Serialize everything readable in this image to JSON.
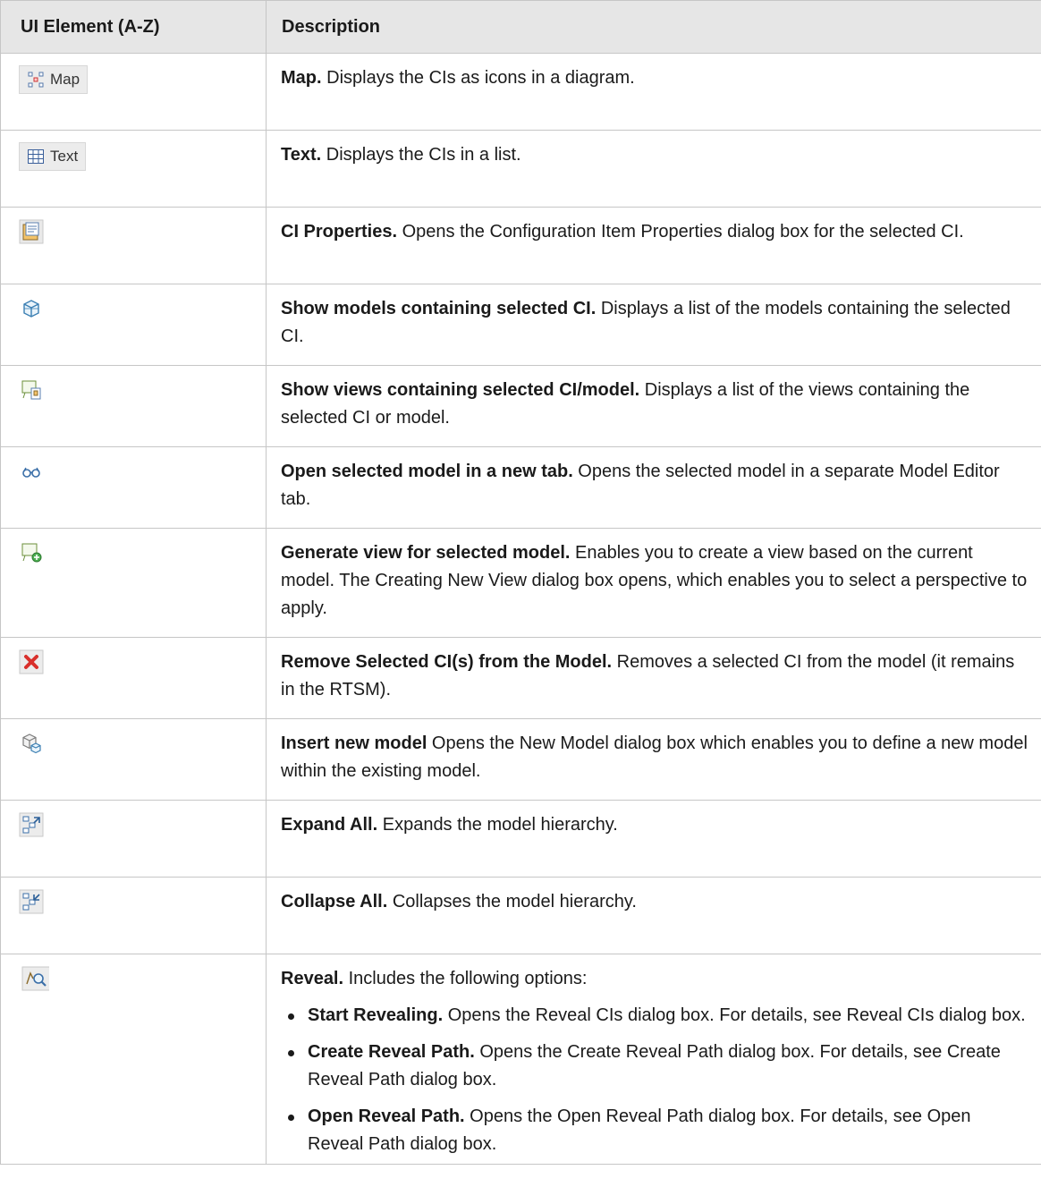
{
  "header": {
    "element": "UI Element (A-Z)",
    "description": "Description"
  },
  "rows": [
    {
      "icon": "map-button-icon",
      "btn_label": "Map",
      "term": "Map.",
      "text": " Displays the CIs as icons in a diagram."
    },
    {
      "icon": "text-button-icon",
      "btn_label": "Text",
      "term": "Text.",
      "text": " Displays the CIs in a list."
    },
    {
      "icon": "ci-properties-icon",
      "term": "CI Properties.",
      "text": " Opens the Configuration Item Properties dialog box for the selected CI."
    },
    {
      "icon": "show-models-icon",
      "term": "Show models containing selected CI.",
      "text": " Displays a list of the models containing the selected CI."
    },
    {
      "icon": "show-views-icon",
      "term": "Show views containing selected CI/model.",
      "text": " Displays a list of the views containing the selected CI or model."
    },
    {
      "icon": "open-model-tab-icon",
      "term": "Open selected model in a new tab.",
      "text": " Opens the selected model in a separate Model Editor tab."
    },
    {
      "icon": "generate-view-icon",
      "term": "Generate view for selected model.",
      "text": " Enables you to create a view based on the current model. The Creating New View dialog box opens, which enables you to select a perspective to apply."
    },
    {
      "icon": "remove-ci-icon",
      "term": "Remove Selected CI(s) from the Model.",
      "text": " Removes a selected CI from the model (it remains in the RTSM)."
    },
    {
      "icon": "insert-model-icon",
      "term": "Insert new model",
      "text": " Opens the New Model dialog box which enables you to define a new model within the existing model."
    },
    {
      "icon": "expand-all-icon",
      "term": "Expand All.",
      "text": " Expands the model hierarchy."
    },
    {
      "icon": "collapse-all-icon",
      "term": "Collapse All.",
      "text": " Collapses the model hierarchy."
    },
    {
      "icon": "reveal-icon",
      "term": "Reveal.",
      "text": " Includes the following options:",
      "options": [
        {
          "term": "Start Revealing.",
          "text": " Opens the Reveal CIs dialog box. For details, see Reveal CIs dialog box."
        },
        {
          "term": "Create Reveal Path.",
          "text": " Opens the Create Reveal Path dialog box. For details, see Create Reveal Path dialog box."
        },
        {
          "term": "Open Reveal Path.",
          "text": " Opens the Open Reveal Path dialog box. For details, see Open Reveal Path dialog box."
        }
      ]
    }
  ]
}
